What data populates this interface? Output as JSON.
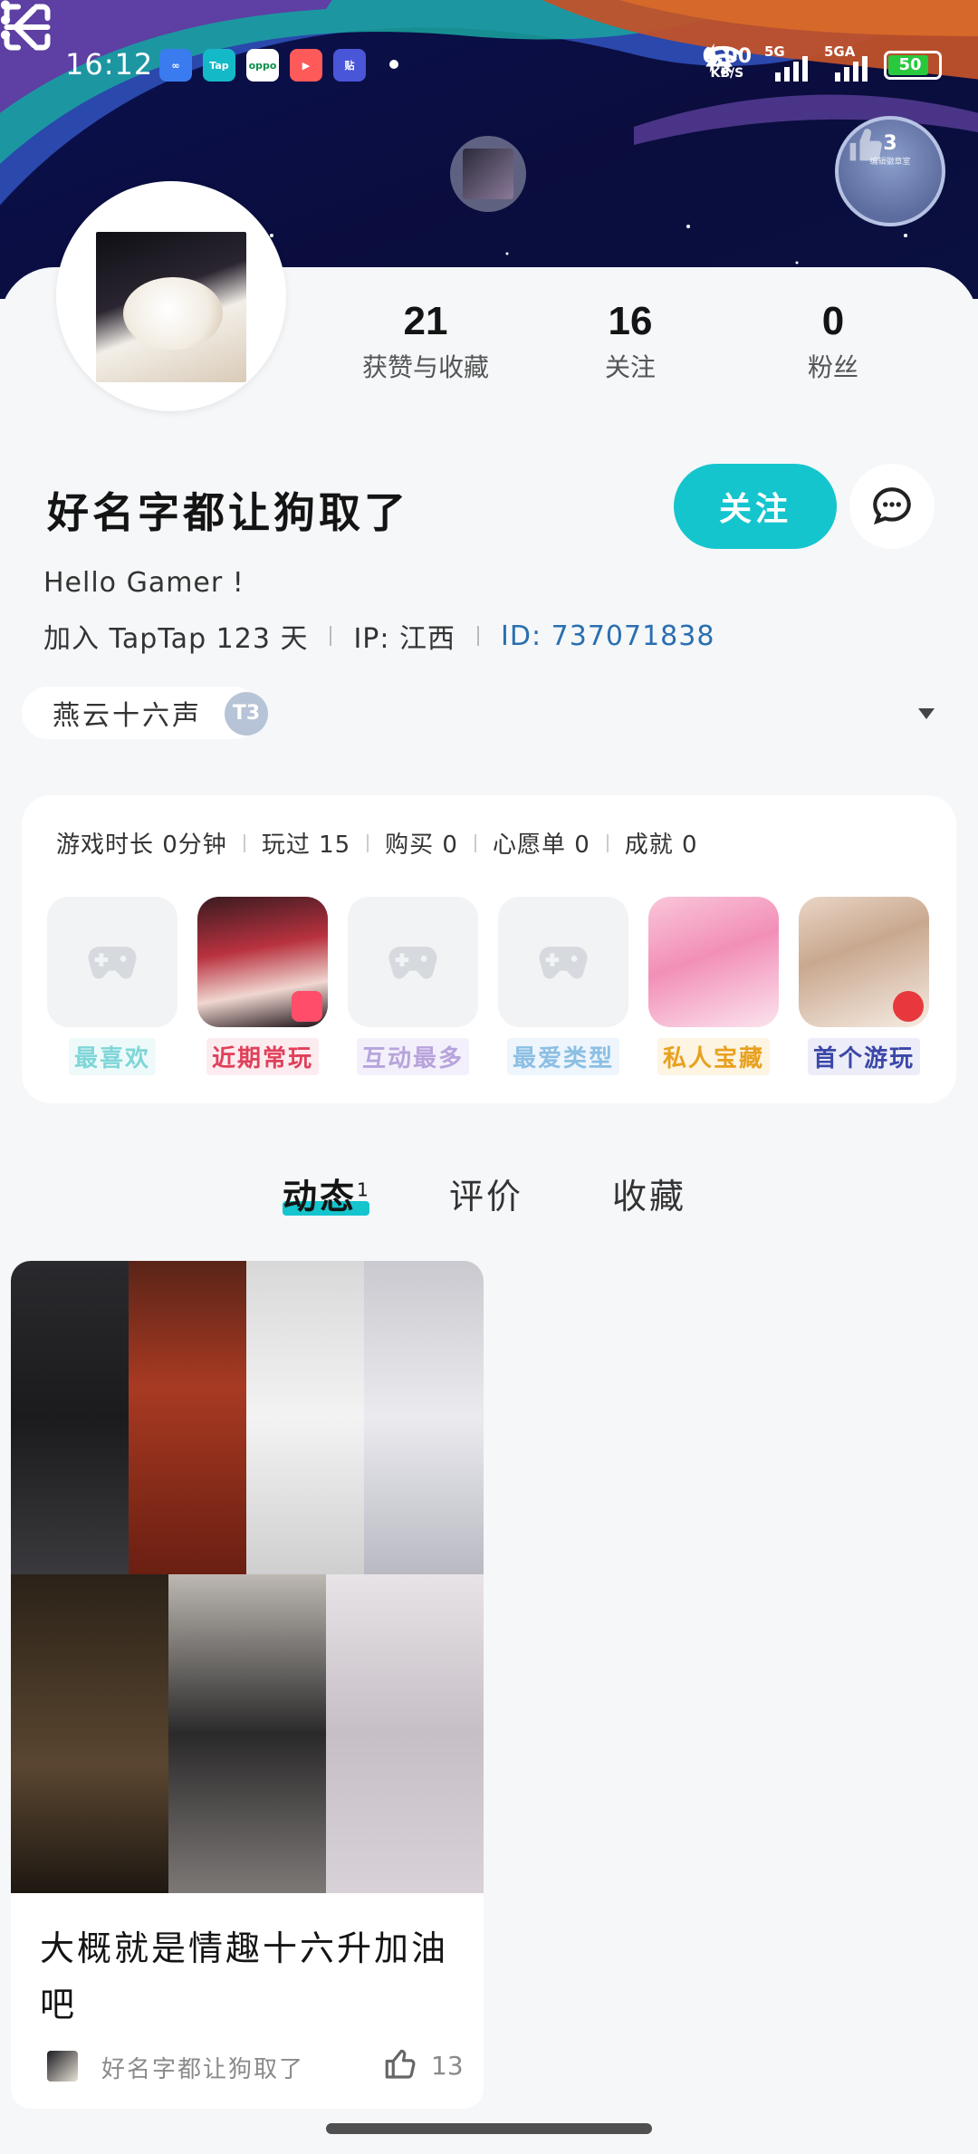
{
  "status_bar": {
    "time": "16:12",
    "net_speed_value": "0.00",
    "net_speed_unit": "KB/S",
    "sim1": "5G",
    "sim2": "5GA",
    "battery": "50",
    "app_icons": [
      "Tap",
      "oppo"
    ]
  },
  "header": {
    "badge_level": "3",
    "badge_caption": "编辑徽章室"
  },
  "stats": [
    {
      "value": "21",
      "label": "获赞与收藏"
    },
    {
      "value": "16",
      "label": "关注"
    },
    {
      "value": "0",
      "label": "粉丝"
    }
  ],
  "profile": {
    "nickname": "好名字都让狗取了",
    "follow_label": "关注",
    "bio": "Hello Gamer !",
    "join_text": "加入 TapTap 123 天",
    "ip_text": "IP: 江西",
    "id_text": "ID: 737071838",
    "game_tag": "燕云十六声",
    "tag_badge": "T3"
  },
  "game_summary": {
    "stats": [
      "游戏时长 0分钟",
      "玩过 15",
      "购买 0",
      "心愿单 0",
      "成就 0"
    ],
    "slots": [
      {
        "label": "最喜欢",
        "color": "#7fd6d8",
        "bg": "#eefafa",
        "icon": "gamepad-icon"
      },
      {
        "label": "近期常玩",
        "color": "#e0405a",
        "bg": "#fdecef",
        "icon": "game-art"
      },
      {
        "label": "互动最多",
        "color": "#b7a4dc",
        "bg": "#f4f0fb",
        "icon": "gamepad-icon"
      },
      {
        "label": "最爱类型",
        "color": "#8cbfe4",
        "bg": "#eef5fc",
        "icon": "gamepad-icon"
      },
      {
        "label": "私人宝藏",
        "color": "#e8a11e",
        "bg": "#fdf4e2",
        "icon": "game-art"
      },
      {
        "label": "首个游玩",
        "color": "#3b47a8",
        "bg": "#ecedf8",
        "icon": "game-art"
      }
    ]
  },
  "tabs": [
    {
      "label": "动态",
      "count": "1",
      "active": true
    },
    {
      "label": "评价",
      "active": false
    },
    {
      "label": "收藏",
      "active": false
    }
  ],
  "post": {
    "title": "大概就是情趣十六升加油吧",
    "author": "好名字都让狗取了",
    "likes": "13"
  },
  "colors": {
    "accent": "#15c5ce",
    "link": "#2a6fb0"
  }
}
